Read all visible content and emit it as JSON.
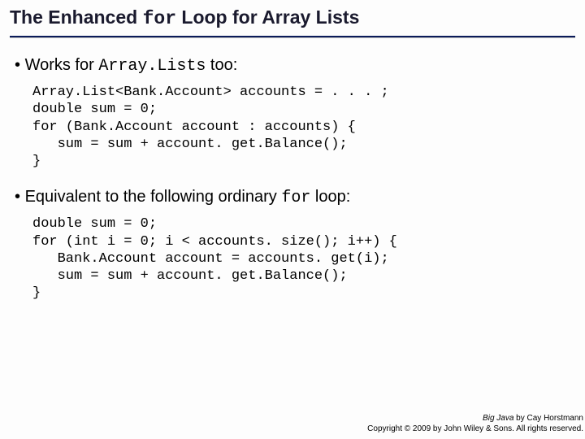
{
  "title": {
    "pre": "The Enhanced ",
    "mono": "for",
    "post": " Loop for Array Lists"
  },
  "bullets": [
    {
      "pre": "Works for ",
      "mono": "Array.Lists",
      "post": " too:"
    },
    {
      "pre": "Equivalent to the following ordinary ",
      "mono": "for",
      "post": " loop:"
    }
  ],
  "code": [
    "Array.List<Bank.Account> accounts = . . . ;\ndouble sum = 0;\nfor (Bank.Account account : accounts) {\n   sum = sum + account. get.Balance();\n}",
    "double sum = 0;\nfor (int i = 0; i < accounts. size(); i++) {\n   Bank.Account account = accounts. get(i);\n   sum = sum + account. get.Balance();\n}"
  ],
  "footer": {
    "line1_em": "Big Java",
    "line1_rest": " by Cay Horstmann",
    "line2": "Copyright © 2009 by John Wiley & Sons.  All rights reserved."
  }
}
